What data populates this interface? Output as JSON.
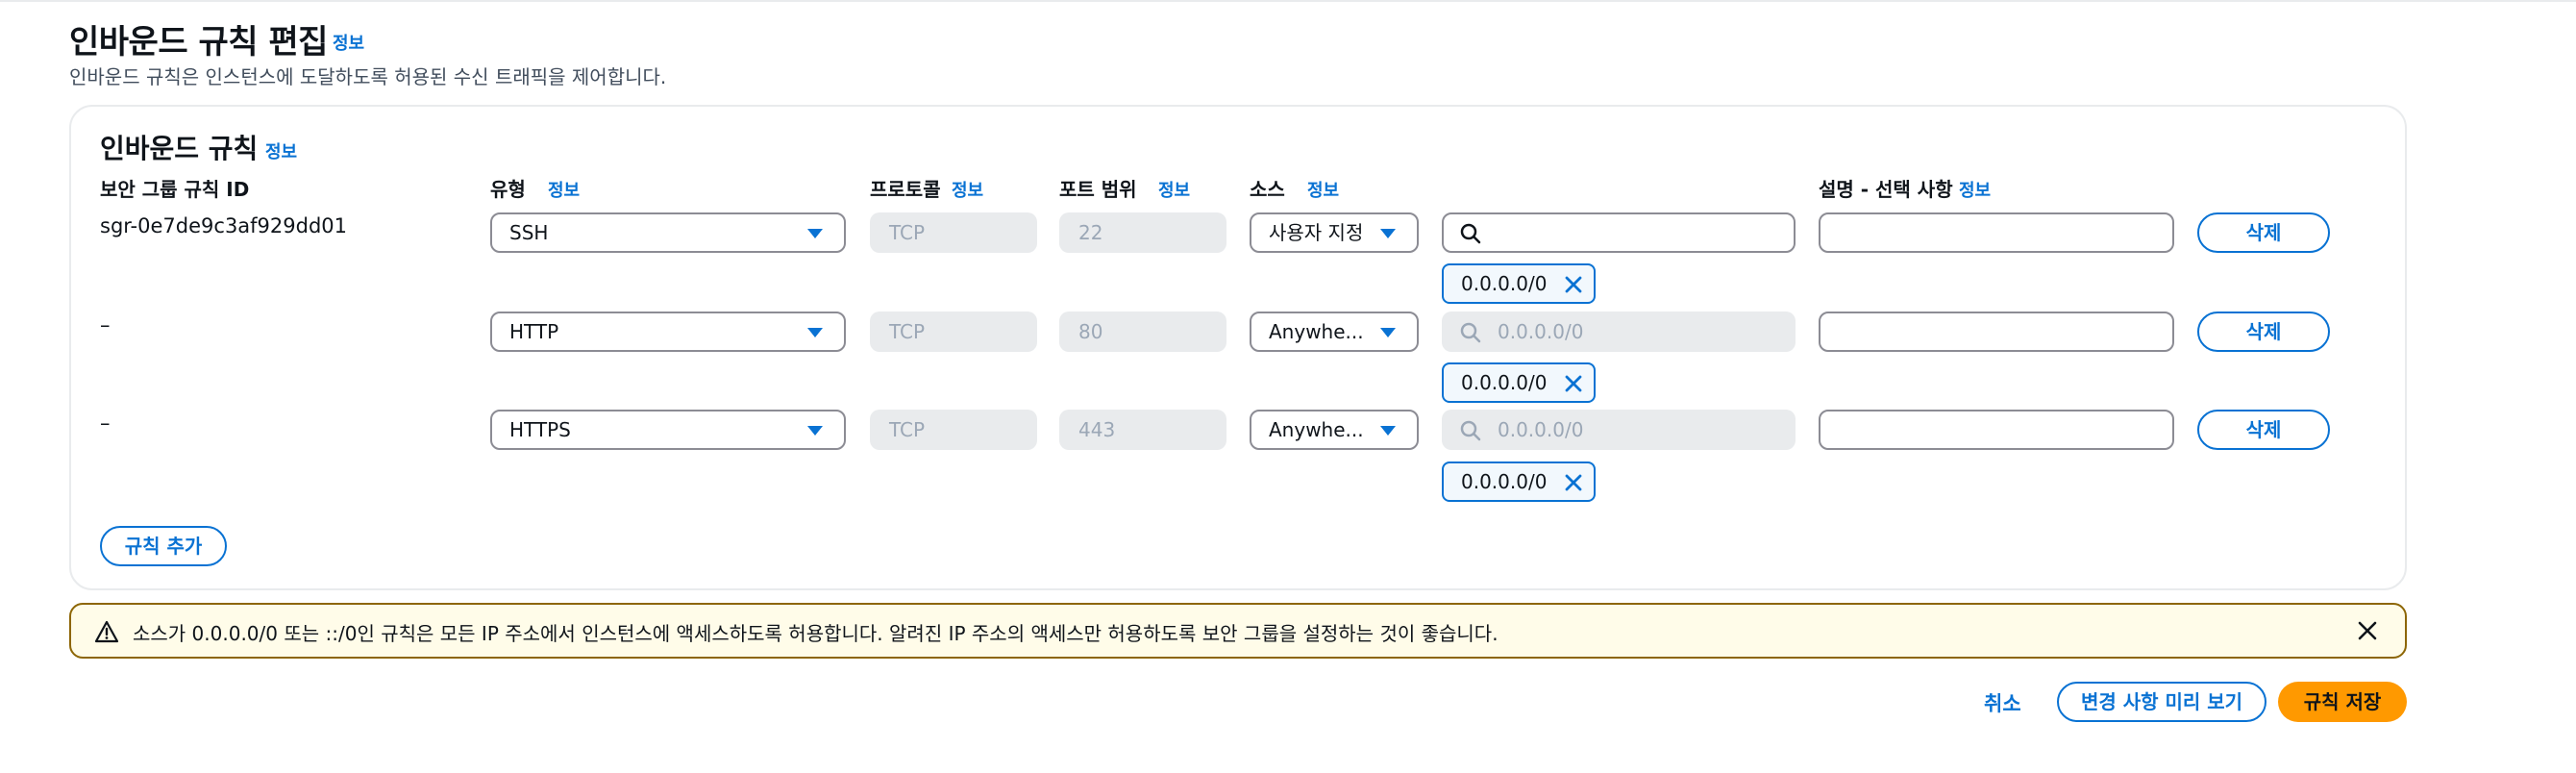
{
  "page": {
    "title": "인바운드 규칙 편집",
    "info": "정보",
    "description": "인바운드 규칙은 인스턴스에 도달하도록 허용된 수신 트래픽을 제어합니다."
  },
  "container": {
    "title": "인바운드 규칙",
    "info": "정보",
    "columns": {
      "rule_id": "보안 그룹 규칙 ID",
      "type": "유형",
      "protocol": "프로토콜",
      "port_range": "포트 범위",
      "source": "소스",
      "description": "설명 - 선택 사항",
      "info": "정보"
    }
  },
  "rules": [
    {
      "id": "sgr-0e7de9c3af929dd01",
      "type": "SSH",
      "protocol": "TCP",
      "port": "22",
      "source": "사용자 지정",
      "search_value": "",
      "token": "0.0.0.0/0",
      "description": "",
      "delete_label": "삭제"
    },
    {
      "id": "–",
      "type": "HTTP",
      "protocol": "TCP",
      "port": "80",
      "source": "Anywhe...",
      "search_value": "0.0.0.0/0",
      "token": "0.0.0.0/0",
      "description": "",
      "delete_label": "삭제"
    },
    {
      "id": "–",
      "type": "HTTPS",
      "protocol": "TCP",
      "port": "443",
      "source": "Anywhe...",
      "search_value": "0.0.0.0/0",
      "token": "0.0.0.0/0",
      "description": "",
      "delete_label": "삭제"
    }
  ],
  "add_rule_label": "규칙 추가",
  "alert": {
    "message": "소스가 0.0.0.0/0 또는 ::/0인 규칙은 모든 IP 주소에서 인스턴스에 액세스하도록 허용합니다. 알려진 IP 주소의 액세스만 허용하도록 보안 그룹을 설정하는 것이 좋습니다."
  },
  "footer": {
    "cancel": "취소",
    "preview": "변경 사항 미리 보기",
    "save": "규칙 저장"
  },
  "colors": {
    "accent": "#0972d3",
    "primary_button": "#ff9900",
    "warning_border": "#8d6605",
    "warning_bg": "#fffce9"
  },
  "icons": {
    "select_caret": "caret-down-icon",
    "search": "search-icon",
    "token_remove": "close-icon",
    "warning": "warning-icon",
    "alert_close": "close-icon"
  }
}
